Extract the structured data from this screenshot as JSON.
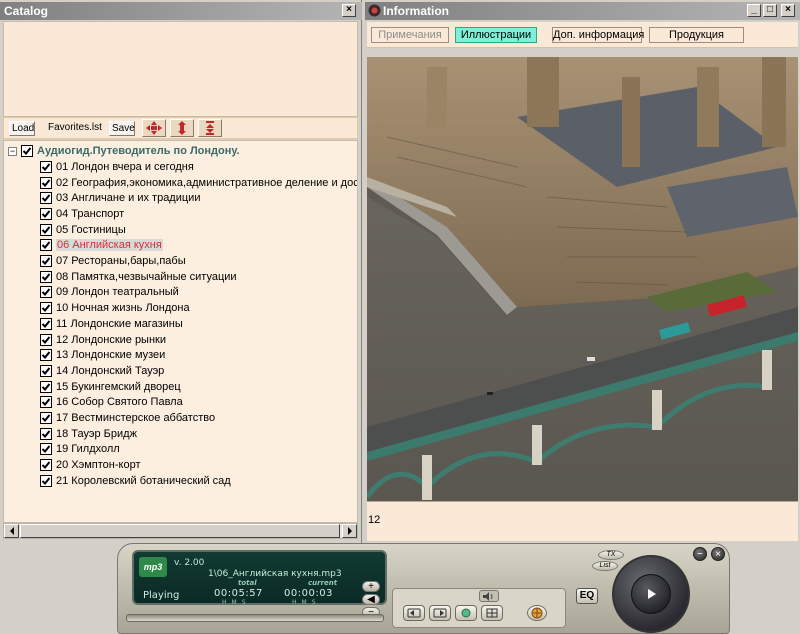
{
  "catalog": {
    "title": "Catalog",
    "close_label": "×",
    "toolbar": {
      "load_label": "Load",
      "favorites_label": "Favorites.lst",
      "save_label": "Save"
    },
    "tree": {
      "root_label": "Аудиогид.Путеводитель по Лондону.",
      "expander": "−",
      "items": [
        "01 Лондон вчера и сегодня",
        "02 География,экономика,административное деление и дост",
        "03 Англичане и их традиции",
        "04 Транспорт",
        "05 Гостиницы",
        "06 Английская кухня",
        "07 Рестораны,бары,пабы",
        "08 Памятка,чезвычайные ситуации",
        "09 Лондон театральный",
        "10 Ночная жизнь Лондона",
        "11 Лондонские магазины",
        "12 Лондонские рынки",
        "13 Лондонские музеи",
        "14 Лондонский Тауэр",
        "15 Букингемский дворец",
        "16 Собор Святого Павла",
        "17 Вестминстерское аббатство",
        "18 Тауэр Бридж",
        "19 Гилдхолл",
        "20 Хэмптон-корт",
        "21  Королевский ботанический сад"
      ],
      "selected_index": 5
    }
  },
  "info": {
    "title": "Information",
    "window_buttons": {
      "minimize": "_",
      "maximize": "□",
      "close": "×"
    },
    "tabs": [
      {
        "label": "Примечания",
        "state": "inactive"
      },
      {
        "label": "Иллюстрации",
        "state": "active"
      },
      {
        "label": "Доп. информация",
        "state": "normal"
      },
      {
        "label": "Продукция",
        "state": "normal"
      }
    ],
    "caption": "12"
  },
  "player": {
    "lcd": {
      "logo": "mp3",
      "version": "v. 2.00",
      "file": "1\\06_Английская кухня.mp3",
      "status": "Playing",
      "total_label": "total",
      "current_label": "current",
      "total_time": "00:05:57",
      "current_time": "00:00:03",
      "hms_label": "HMS"
    },
    "volume": {
      "up": "+",
      "mute": "◀",
      "down": "−"
    },
    "eq_label": "EQ",
    "window_controls": {
      "minimize": "−",
      "close": "×"
    },
    "small_buttons": {
      "top": "TX",
      "bottom": "List"
    }
  },
  "colors": {
    "title_gradient_start": "#808080",
    "panel_bg": "#fbe9d7",
    "active_tab": "#7ef0d6",
    "selected_item": "#d83030",
    "root_label": "#3c6a6a"
  }
}
